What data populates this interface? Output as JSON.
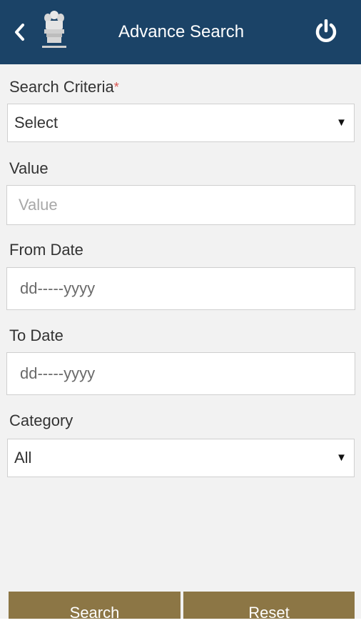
{
  "header": {
    "title": "Advance Search",
    "back_icon": "chevron-left-icon",
    "emblem_icon": "national-emblem-icon",
    "power_icon": "power-icon",
    "background_color": "#1b4367"
  },
  "form": {
    "search_criteria": {
      "label": "Search Criteria",
      "required_mark": "*",
      "value": "Select"
    },
    "value_field": {
      "label": "Value",
      "placeholder": "Value"
    },
    "from_date": {
      "label": "From Date",
      "value": "dd-----yyyy"
    },
    "to_date": {
      "label": "To Date",
      "value": "dd-----yyyy"
    },
    "category": {
      "label": "Category",
      "value": "All"
    },
    "dropdown_arrow": "▼"
  },
  "buttons": {
    "search_label": "Search",
    "reset_label": "Reset",
    "color": "#8c7645"
  }
}
